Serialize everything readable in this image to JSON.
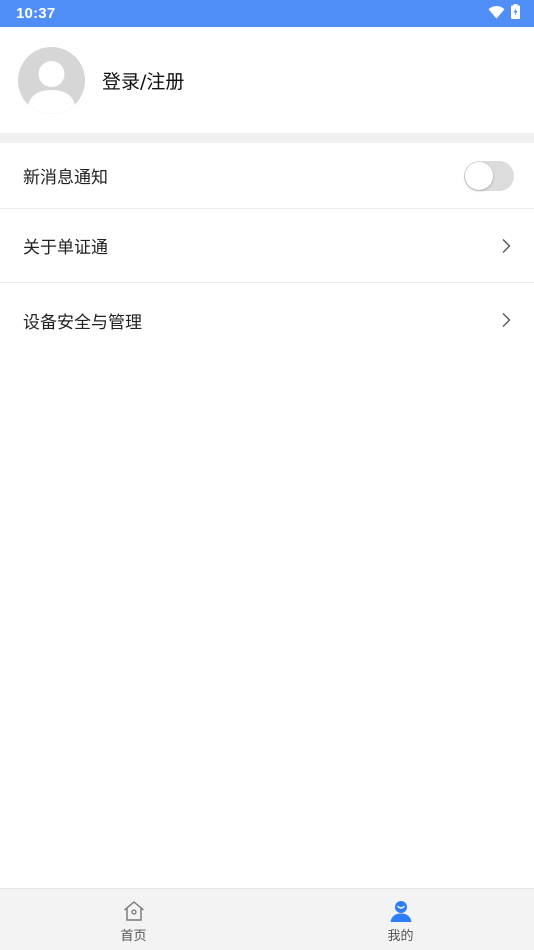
{
  "status_bar": {
    "time": "10:37",
    "icons": [
      "wifi-icon",
      "battery-charging-icon"
    ],
    "background": "#4f8ef7"
  },
  "profile": {
    "login_label": "登录/注册",
    "avatar_icon": "default-avatar-icon"
  },
  "settings": {
    "notification": {
      "label": "新消息通知",
      "enabled": false
    },
    "about": {
      "label": "关于单证通",
      "icon": "chevron-right-icon"
    },
    "device_security": {
      "label": "设备安全与管理",
      "icon": "chevron-right-icon"
    }
  },
  "bottom_nav": {
    "items": [
      {
        "label": "首页",
        "icon": "home-icon",
        "active": false
      },
      {
        "label": "我的",
        "icon": "user-icon",
        "active": true
      }
    ],
    "active_color": "#2d7ff9"
  }
}
